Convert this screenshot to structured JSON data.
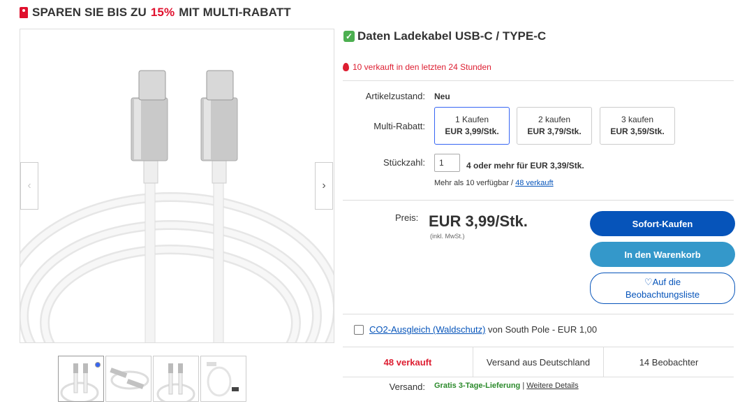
{
  "promo": {
    "prefix": "SPAREN SIE BIS ZU",
    "percent": "15%",
    "suffix": "MIT MULTI-RABATT",
    "icon": "price-tag-icon",
    "accent_color": "#e0102d"
  },
  "gallery": {
    "prev_icon": "chevron-left-icon",
    "next_icon": "chevron-right-icon",
    "thumbnails": [
      "thumb-1",
      "thumb-2",
      "thumb-3",
      "thumb-4"
    ]
  },
  "product": {
    "title": "Daten Ladekabel USB-C / TYPE-C",
    "title_icon": "check-mark-icon",
    "recent_sales": "10 verkauft in den letzten 24 Stunden",
    "recent_sales_icon": "flame-icon"
  },
  "details": {
    "condition_label": "Artikelzustand:",
    "condition_value": "Neu",
    "multi_label": "Multi-Rabatt:",
    "options": [
      {
        "qty": "1 Kaufen",
        "price": "EUR 3,99/Stk.",
        "selected": true
      },
      {
        "qty": "2 kaufen",
        "price": "EUR 3,79/Stk.",
        "selected": false
      },
      {
        "qty": "3 kaufen",
        "price": "EUR 3,59/Stk.",
        "selected": false
      }
    ],
    "quantity_label": "Stückzahl:",
    "quantity_value": "1",
    "quantity_info": "4 oder mehr für EUR 3,39/Stk.",
    "availability": "Mehr als 10 verfügbar /",
    "sold_link": "48 verkauft"
  },
  "pricing": {
    "label": "Preis:",
    "price": "EUR 3,99/Stk.",
    "vat": "(inkl. MwSt.)"
  },
  "actions": {
    "buy_now": "Sofort-Kaufen",
    "add_to_cart": "In den Warenkorb",
    "watch_line1": "Auf die",
    "watch_line2": "Beobachtungsliste",
    "watch_icon": "heart-icon",
    "buy_color": "#0654ba",
    "cart_color": "#3498ca"
  },
  "co2": {
    "link": "CO2-Ausgleich (Waldschutz)",
    "text": "von South Pole - EUR 1,00"
  },
  "stats": {
    "sold": "48 verkauft",
    "shipping_origin": "Versand aus Deutschland",
    "watchers": "14 Beobachter"
  },
  "shipping": {
    "label": "Versand:",
    "free": "Gratis 3-Tage-Lieferung",
    "separator": "|",
    "details_link": "Weitere Details"
  }
}
